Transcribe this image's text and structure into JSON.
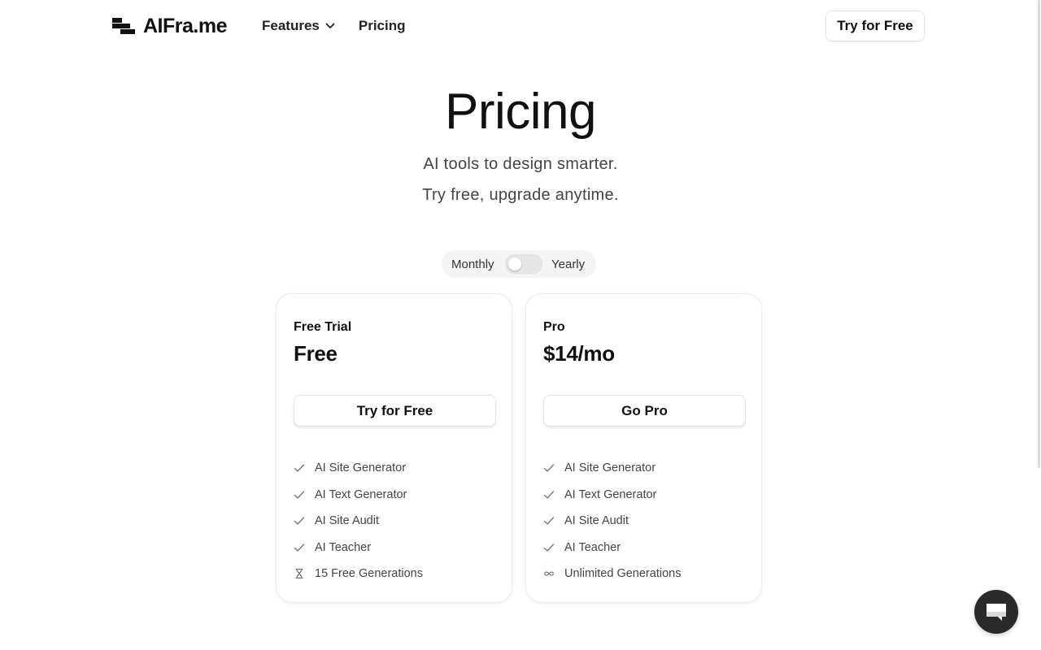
{
  "header": {
    "logo_text": "AIFra.me",
    "nav": {
      "features_label": "Features",
      "pricing_label": "Pricing"
    },
    "cta_label": "Try for Free"
  },
  "hero": {
    "title": "Pricing",
    "subtitle_line1": "AI tools to design smarter.",
    "subtitle_line2": "Try free, upgrade anytime."
  },
  "billing_toggle": {
    "monthly_label": "Monthly",
    "yearly_label": "Yearly",
    "selected": "Monthly"
  },
  "plans": [
    {
      "name": "Free Trial",
      "price": "Free",
      "button_label": "Try for Free",
      "features": [
        {
          "icon": "check-icon",
          "label": "AI Site Generator"
        },
        {
          "icon": "check-icon",
          "label": "AI Text Generator"
        },
        {
          "icon": "check-icon",
          "label": "AI Site Audit"
        },
        {
          "icon": "check-icon",
          "label": "AI Teacher"
        },
        {
          "icon": "hourglass-icon",
          "label": "15 Free Generations"
        }
      ]
    },
    {
      "name": "Pro",
      "price": "$14/mo",
      "button_label": "Go Pro",
      "features": [
        {
          "icon": "check-icon",
          "label": "AI Site Generator"
        },
        {
          "icon": "check-icon",
          "label": "AI Text Generator"
        },
        {
          "icon": "check-icon",
          "label": "AI Site Audit"
        },
        {
          "icon": "check-icon",
          "label": "AI Teacher"
        },
        {
          "icon": "infinity-icon",
          "label": "Unlimited Generations"
        }
      ]
    }
  ],
  "colors": {
    "text": "#111111",
    "muted": "#444444",
    "chat_bg": "#2a2a2a"
  }
}
